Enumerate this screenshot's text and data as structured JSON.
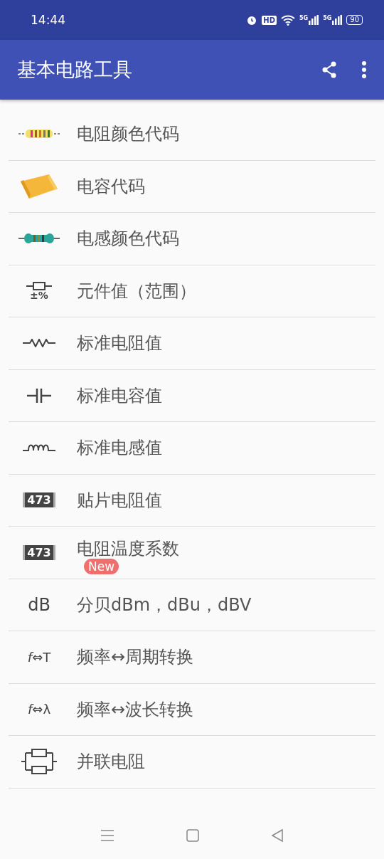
{
  "status_bar": {
    "time": "14:44",
    "hd": "HD",
    "networks": [
      "5G",
      "5G"
    ],
    "battery": "90"
  },
  "app_bar": {
    "title": "基本电路工具"
  },
  "items": [
    {
      "kind": "resistor-color",
      "label": "电阻颜色代码"
    },
    {
      "kind": "capacitor-chip",
      "label": "电容代码"
    },
    {
      "kind": "inductor-color",
      "label": "电感颜色代码"
    },
    {
      "kind": "tolerance",
      "icon_text": "±%",
      "label": "元件值（范围）"
    },
    {
      "kind": "resistor-symbol",
      "label": "标准电阻值"
    },
    {
      "kind": "capacitor-symbol",
      "label": "标准电容值"
    },
    {
      "kind": "inductor-symbol",
      "label": "标准电感值"
    },
    {
      "kind": "smd-code",
      "icon_text": "473",
      "label": "贴片电阻值"
    },
    {
      "kind": "smd-code",
      "icon_text": "473",
      "label": "电阻温度系数",
      "badge": "New"
    },
    {
      "kind": "text",
      "icon_text": "dB",
      "label": "分贝dBm，dBu，dBV"
    },
    {
      "kind": "text",
      "icon_text": "*f*⇔T",
      "label": "频率↔周期转换"
    },
    {
      "kind": "text",
      "icon_text": "*f*⇔λ",
      "label": "频率↔波长转换"
    },
    {
      "kind": "parallel-resistor",
      "label": "并联电阻"
    }
  ]
}
